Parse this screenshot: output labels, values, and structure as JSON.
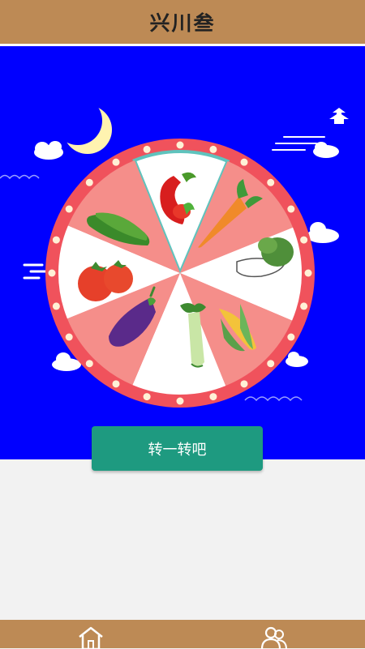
{
  "header": {
    "title": "兴川叁"
  },
  "wheel": {
    "segments": [
      {
        "name": "chili-pepper",
        "fill": "#ffffff"
      },
      {
        "name": "carrot",
        "fill": "#f58e8a"
      },
      {
        "name": "bok-choy",
        "fill": "#ffffff"
      },
      {
        "name": "corn",
        "fill": "#f58e8a"
      },
      {
        "name": "celery",
        "fill": "#ffffff"
      },
      {
        "name": "eggplant",
        "fill": "#f58e8a"
      },
      {
        "name": "tomato",
        "fill": "#ffffff"
      },
      {
        "name": "cucumber",
        "fill": "#f58e8a"
      }
    ],
    "rim_color": "#f0525c",
    "highlight_color": "#5fc3bd"
  },
  "spin_button": {
    "label": "转一转吧"
  },
  "footer": {
    "nav": [
      {
        "icon": "home-icon"
      },
      {
        "icon": "users-icon"
      }
    ]
  },
  "colors": {
    "header": "#bd8a55",
    "stage": "#0000ff",
    "button": "#1e9a80",
    "page": "#f2f2f2"
  }
}
